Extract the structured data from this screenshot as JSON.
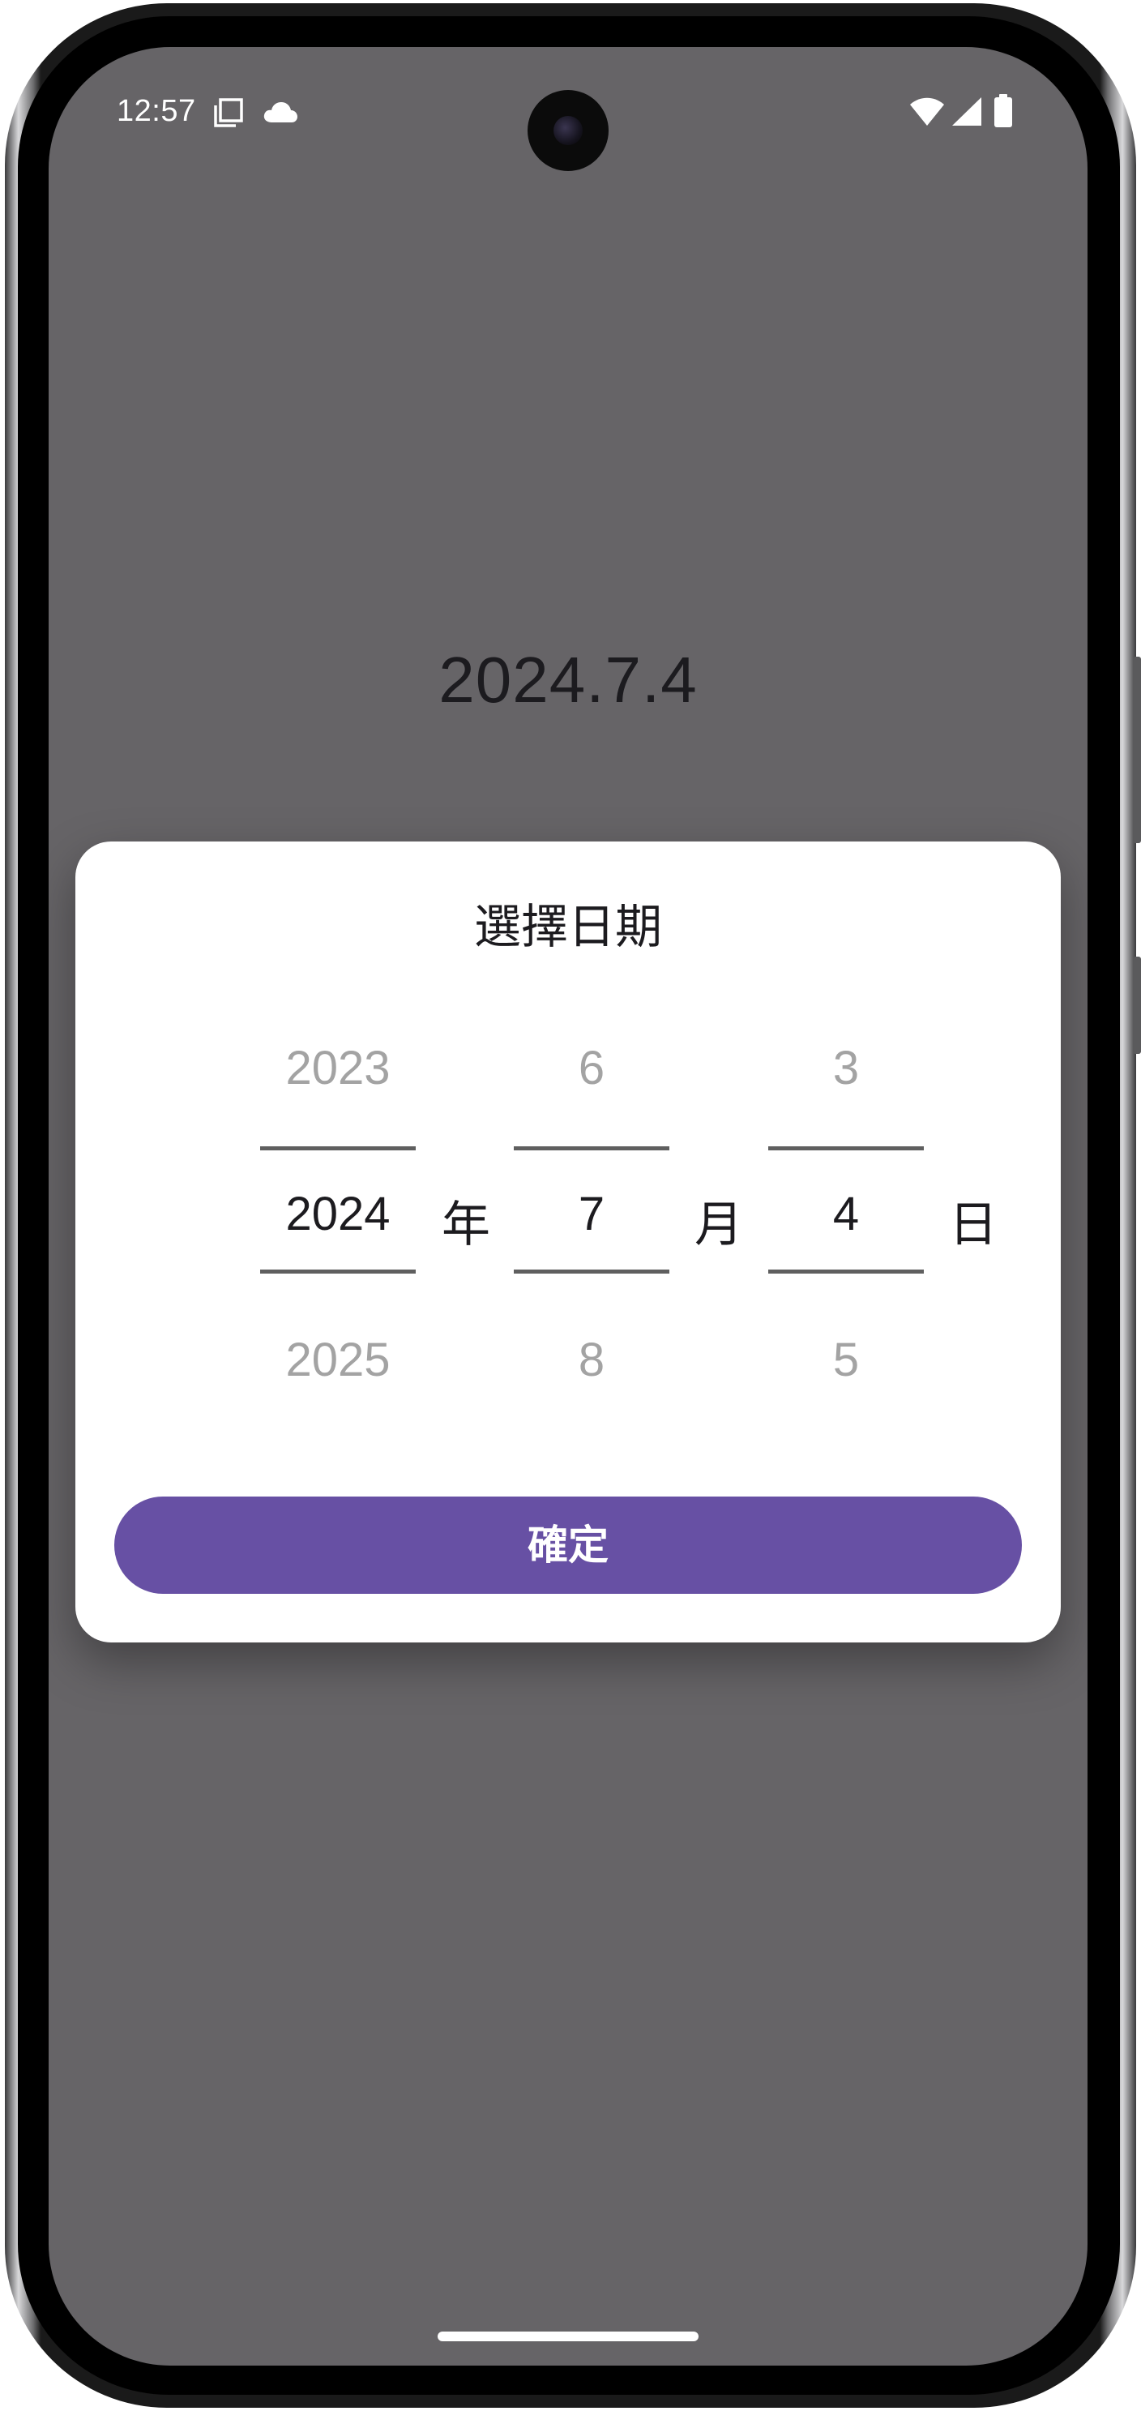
{
  "status_bar": {
    "time": "12:57",
    "icons": [
      "screenshot-icon",
      "cloud-icon",
      "wifi-icon",
      "signal-icon",
      "battery-icon"
    ]
  },
  "main": {
    "date_display": "2024.7.4"
  },
  "dialog": {
    "title": "選擇日期",
    "year": {
      "prev": "2023",
      "selected": "2024",
      "next": "2025",
      "unit": "年"
    },
    "month": {
      "prev": "6",
      "selected": "7",
      "next": "8",
      "unit": "月"
    },
    "day": {
      "prev": "3",
      "selected": "4",
      "next": "5",
      "unit": "日"
    },
    "confirm_label": "確定"
  },
  "colors": {
    "scrim_background": "#666467",
    "primary_button": "#6750a4",
    "dialog_background": "#ffffff",
    "dim_text": "#a3a3a3"
  }
}
